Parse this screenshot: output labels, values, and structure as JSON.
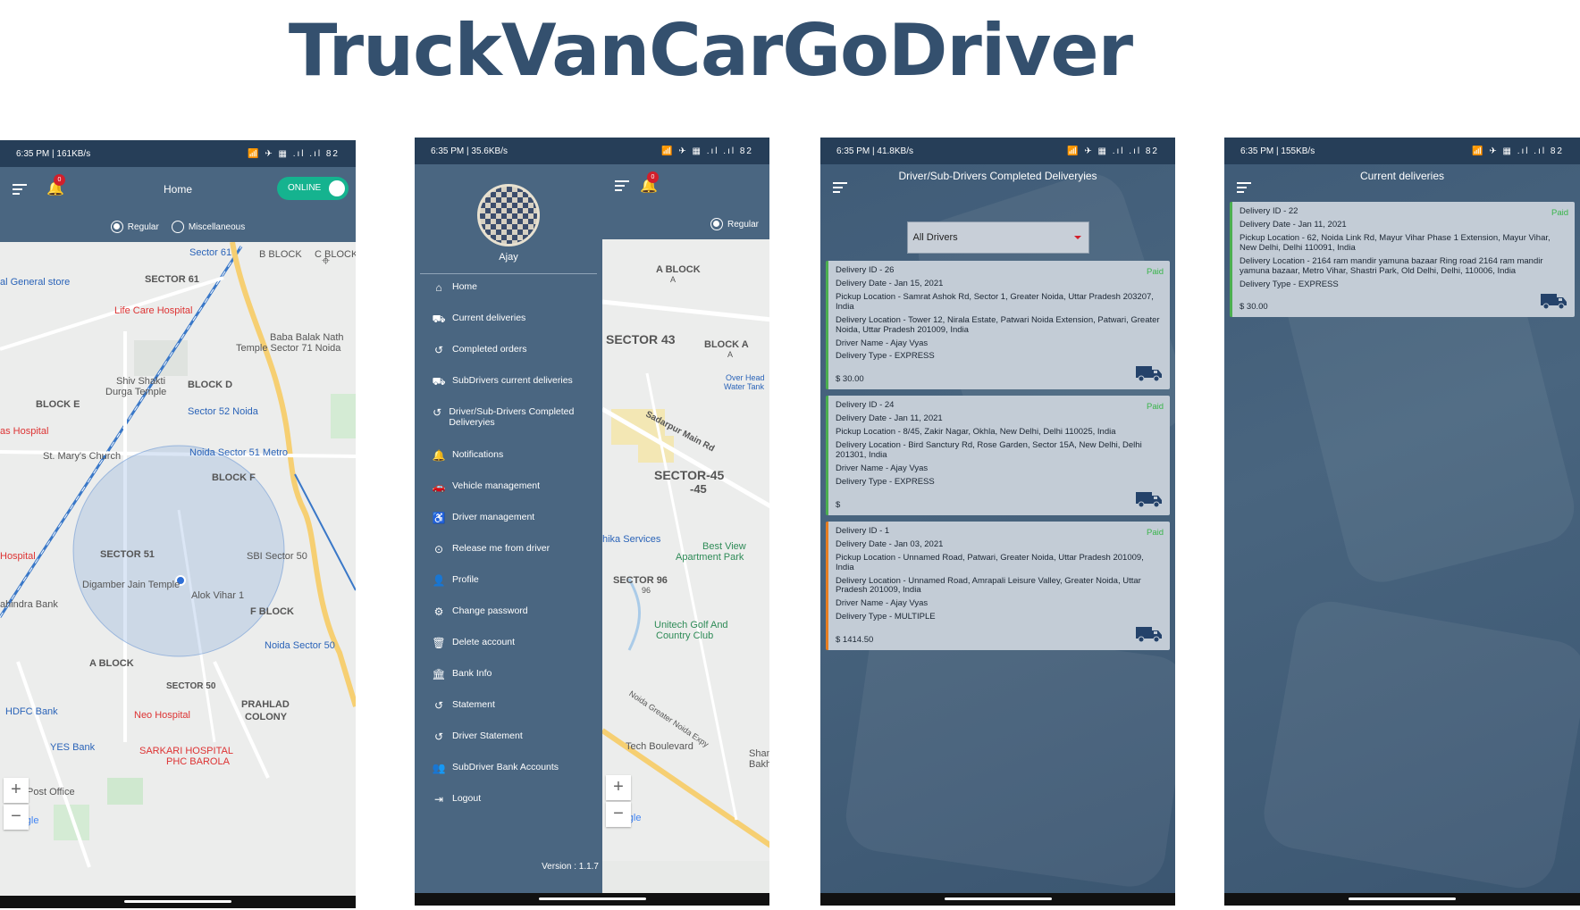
{
  "page": {
    "title": "TruckVanCarGoDriver"
  },
  "colors": {
    "primary": "#4a6681",
    "statusbar": "#263e58",
    "online": "#15b38f",
    "paid": "#39b54a",
    "badge": "#d21f2b"
  },
  "screen1": {
    "status_time": "6:35 PM | 161KB/s",
    "status_icons": "📶 ✈ ▦ .ıl .ıl 82",
    "notification_count": "0",
    "title": "Home",
    "toggle_label": "ONLINE",
    "radio_regular": "Regular",
    "radio_misc": "Miscellaneous",
    "map_labels": {
      "general_store": "al General store",
      "sector61": "SECTOR 61",
      "sector61b": "61",
      "sector61c": "Sector 61",
      "bblock": "B BLOCK",
      "cblock": "C BLOCK",
      "lifecare": "Life Care Hospital",
      "bababalak": "Baba Balak Nath",
      "temple71": "Temple Sector 71 Noida",
      "shivshakti": "Shiv Shakti",
      "durga": "Durga Temple",
      "blockd": "BLOCK D",
      "blocke": "BLOCK E",
      "sector52": "Sector 52 Noida",
      "sector52b": "52",
      "hospital1": "as Hospital",
      "stmarys": "St. Mary's Church",
      "metro51": "Noida Sector 51 Metro",
      "blockf": "BLOCK F",
      "sector51": "SECTOR 51",
      "hospital2": "Hospital",
      "sbi": "SBI Sector 50",
      "digamber": "Digamber Jain Temple",
      "alok": "Alok Vihar 1",
      "fblock": "F BLOCK",
      "mahindra": "ahindra Bank",
      "noida50": "Noida Sector 50",
      "ablock": "A BLOCK",
      "sector50": "SECTOR 50",
      "prahlad": "PRAHLAD",
      "colony": "COLONY",
      "hdfc": "HDFC Bank",
      "neo": "Neo Hospital",
      "yes": "YES Bank",
      "sarkari": "SARKARI HOSPITAL",
      "phc": "PHC BAROLA",
      "post": "Post Office",
      "google": "Google"
    }
  },
  "screen2": {
    "status_time": "6:35 PM | 35.6KB/s",
    "status_icons": "📶 ✈ ▦ .ıl .ıl 82",
    "notification_count": "0",
    "user_name": "Ajay",
    "radio_regular": "Regular",
    "menu": [
      {
        "icon": "home-icon",
        "glyph": "⌂",
        "label": "Home"
      },
      {
        "icon": "truck-icon",
        "glyph": "⛟",
        "label": "Current deliveries"
      },
      {
        "icon": "history-icon",
        "glyph": "↺",
        "label": "Completed orders"
      },
      {
        "icon": "truck-icon",
        "glyph": "⛟",
        "label": "SubDrivers current deliveries"
      },
      {
        "icon": "history-icon",
        "glyph": "↺",
        "label": "Driver/Sub-Drivers Completed Deliveryies"
      },
      {
        "icon": "bell-icon",
        "glyph": "🔔",
        "label": "Notifications"
      },
      {
        "icon": "car-icon",
        "glyph": "🚗",
        "label": "Vehicle management"
      },
      {
        "icon": "driver-icon",
        "glyph": "♿",
        "label": "Driver management"
      },
      {
        "icon": "release-icon",
        "glyph": "⊙",
        "label": "Release me from driver"
      },
      {
        "icon": "person-icon",
        "glyph": "👤",
        "label": "Profile"
      },
      {
        "icon": "gear-icon",
        "glyph": "⚙",
        "label": "Change password"
      },
      {
        "icon": "trash-icon",
        "glyph": "🗑",
        "label": "Delete account"
      },
      {
        "icon": "bank-icon",
        "glyph": "🏛",
        "label": "Bank Info"
      },
      {
        "icon": "history-icon",
        "glyph": "↺",
        "label": "Statement"
      },
      {
        "icon": "history-icon",
        "glyph": "↺",
        "label": "Driver Statement"
      },
      {
        "icon": "group-icon",
        "glyph": "👥",
        "label": "SubDriver Bank Accounts"
      },
      {
        "icon": "logout-icon",
        "glyph": "⇥",
        "label": "Logout"
      }
    ],
    "version": "Version : 1.1.7",
    "map_labels": {
      "ablock": "A BLOCK",
      "ablockb": "A",
      "sector43": "SECTOR 43",
      "blocka": "BLOCK A",
      "blockab": "A",
      "overhead": "Over Head",
      "tank": "Water Tank",
      "sadarpur": "Sadarpur Main Rd",
      "sector45": "SECTOR-45",
      "sector45b": "-45",
      "services": "hika Services",
      "bestview": "Best View",
      "apartment": "Apartment Park",
      "sector96": "SECTOR 96",
      "sector96b": "96",
      "unitech": "Unitech Golf And",
      "country": "Country Club",
      "expy": "Noida Greater Noida Expy",
      "tech": "Tech Boulevard",
      "shani": "Shani",
      "bakht": "Bakht",
      "google": "Google"
    }
  },
  "screen3": {
    "status_time": "6:35 PM | 41.8KB/s",
    "status_icons": "📶 ✈ ▦ .ıl .ıl 82",
    "title": "Driver/Sub-Drivers Completed Deliveryies",
    "filter_value": "All Drivers",
    "cards": [
      {
        "id": "Delivery ID - 26",
        "date": "Delivery Date - Jan 15, 2021",
        "pickup": "Pickup Location - Samrat Ashok Rd, Sector 1, Greater Noida, Uttar Pradesh 203207, India",
        "delivery": "Delivery Location - Tower 12, Nirala Estate, Patwari Noida Extension, Patwari, Greater Noida, Uttar Pradesh 201009, India",
        "driver": "Driver Name  - Ajay Vyas",
        "type": "Delivery Type - EXPRESS",
        "price": "$ 30.00",
        "status": "Paid"
      },
      {
        "id": "Delivery ID - 24",
        "date": "Delivery Date - Jan 11, 2021",
        "pickup": "Pickup Location - 8/45, Zakir Nagar, Okhla, New Delhi, Delhi 110025, India",
        "delivery": "Delivery Location - Bird Sanctury Rd, Rose Garden, Sector 15A, New Delhi, Delhi 201301, India",
        "driver": "Driver Name  - Ajay Vyas",
        "type": "Delivery Type - EXPRESS",
        "price": "$",
        "status": "Paid"
      },
      {
        "id": "Delivery ID - 1",
        "date": "Delivery Date - Jan 03, 2021",
        "pickup": "Pickup Location - Unnamed Road, Patwari, Greater Noida, Uttar Pradesh 201009, India",
        "delivery": "Delivery Location - Unnamed Road, Amrapali Leisure Valley, Greater Noida, Uttar Pradesh 201009, India",
        "driver": "Driver Name  - Ajay Vyas",
        "type": "Delivery Type - MULTIPLE",
        "price": "$ 1414.50",
        "status": "Paid"
      }
    ]
  },
  "screen4": {
    "status_time": "6:35 PM | 155KB/s",
    "status_icons": "📶 ✈ ▦ .ıl .ıl 82",
    "title": "Current deliveries",
    "cards": [
      {
        "id": "Delivery ID - 22",
        "date": "Delivery Date - Jan 11, 2021",
        "pickup": "Pickup Location - 62, Noida Link Rd, Mayur Vihar Phase 1 Extension, Mayur Vihar, New Delhi, Delhi 110091, India",
        "delivery": "Delivery Location - 2164 ram mandir yamuna bazaar Ring road 2164 ram mandir yamuna bazaar, Metro Vihar, Shastri Park, Old Delhi, Delhi, 110006, India",
        "type": "Delivery Type - EXPRESS",
        "price": "$ 30.00",
        "status": "Paid"
      }
    ]
  }
}
